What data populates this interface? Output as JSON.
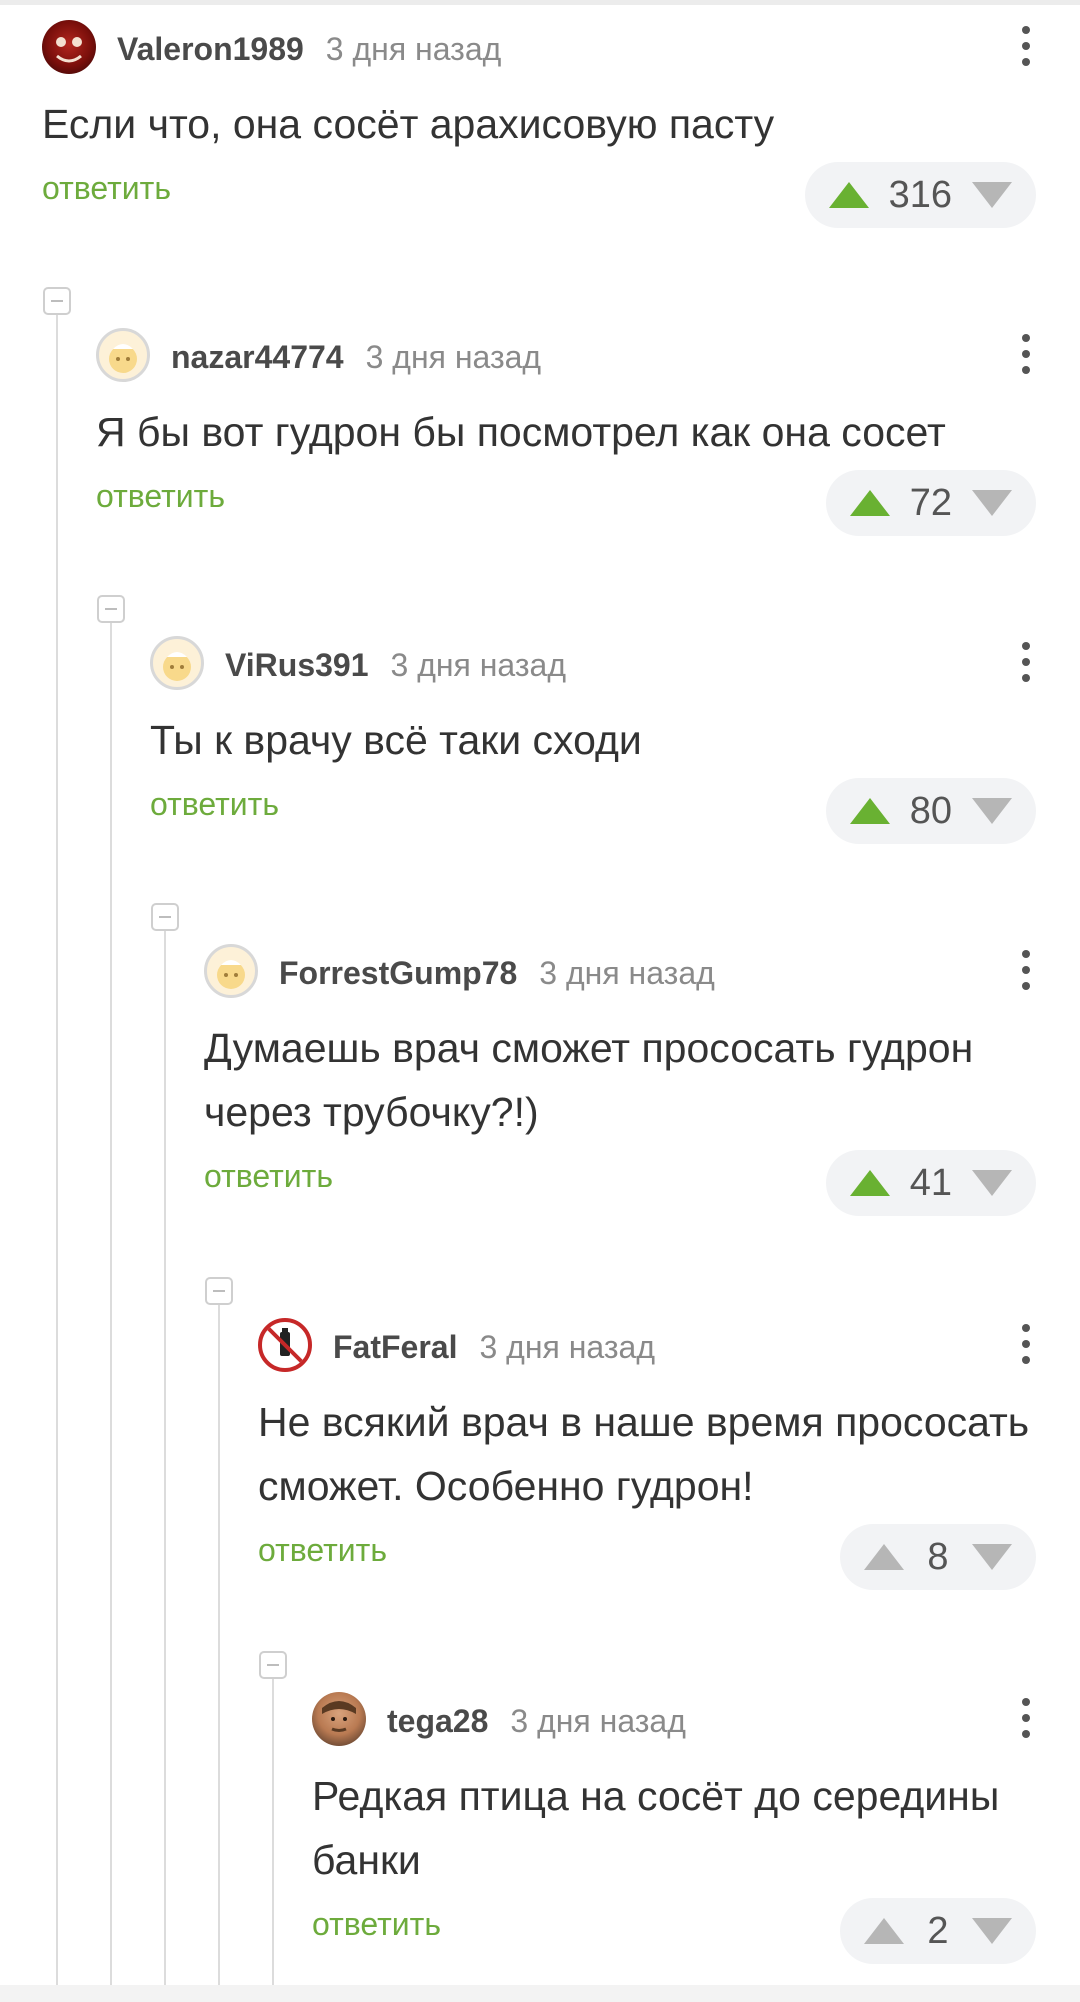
{
  "comments": [
    {
      "user": "Valeron1989",
      "time": "3 дня назад",
      "text": "Если что, она сосёт арахисовую пасту",
      "reply": "ответить",
      "score": "316",
      "up_active": true
    },
    {
      "user": "nazar44774",
      "time": "3 дня назад",
      "text": "Я бы вот гудрон бы посмотрел как она сосет",
      "reply": "ответить",
      "score": "72",
      "up_active": true
    },
    {
      "user": "ViRus391",
      "time": "3 дня назад",
      "text": "Ты к врачу всё таки сходи",
      "reply": "ответить",
      "score": "80",
      "up_active": true
    },
    {
      "user": "ForrestGump78",
      "time": "3 дня назад",
      "text": "Думаешь врач сможет прососать гудрон через трубочку?!)",
      "reply": "ответить",
      "score": "41",
      "up_active": true
    },
    {
      "user": "FatFeral",
      "time": "3 дня назад",
      "text": "Не всякий врач в наше время прососать сможет. Особенно гудрон!",
      "reply": "ответить",
      "score": "8",
      "up_active": false
    },
    {
      "user": "tega28",
      "time": "3 дня назад",
      "text": "Редкая птица на сосёт до середины банки",
      "reply": "ответить",
      "score": "2",
      "up_active": false
    }
  ],
  "colors": {
    "accent": "#6dab3c",
    "upvote": "#69b132",
    "muted": "#8a8a8a"
  }
}
